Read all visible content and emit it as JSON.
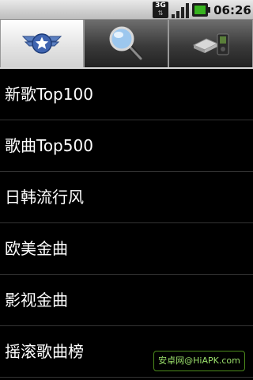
{
  "status_bar": {
    "network_type": "3G",
    "time": "06:26",
    "icons": [
      "network-3g-icon",
      "signal-strength-icon",
      "battery-charging-icon"
    ]
  },
  "tabs": [
    {
      "name": "rank",
      "icon": "badge-star-icon",
      "selected": true
    },
    {
      "name": "search",
      "icon": "magnifier-icon",
      "selected": false
    },
    {
      "name": "local",
      "icon": "usb-drive-icon",
      "selected": false
    }
  ],
  "list": {
    "items": [
      {
        "label": "新歌Top100"
      },
      {
        "label": "歌曲Top500"
      },
      {
        "label": "日韩流行风"
      },
      {
        "label": "欧美金曲"
      },
      {
        "label": "影视金曲"
      },
      {
        "label": "摇滚歌曲榜"
      }
    ]
  },
  "watermark": {
    "text": "安卓网@HiAPK.com"
  },
  "colors": {
    "background": "#000000",
    "text": "#ffffff",
    "divider": "#333333",
    "tab_selected": "#e6e6e6",
    "tab_unselected": "#3a3a3a",
    "watermark_text": "#9be06b"
  }
}
